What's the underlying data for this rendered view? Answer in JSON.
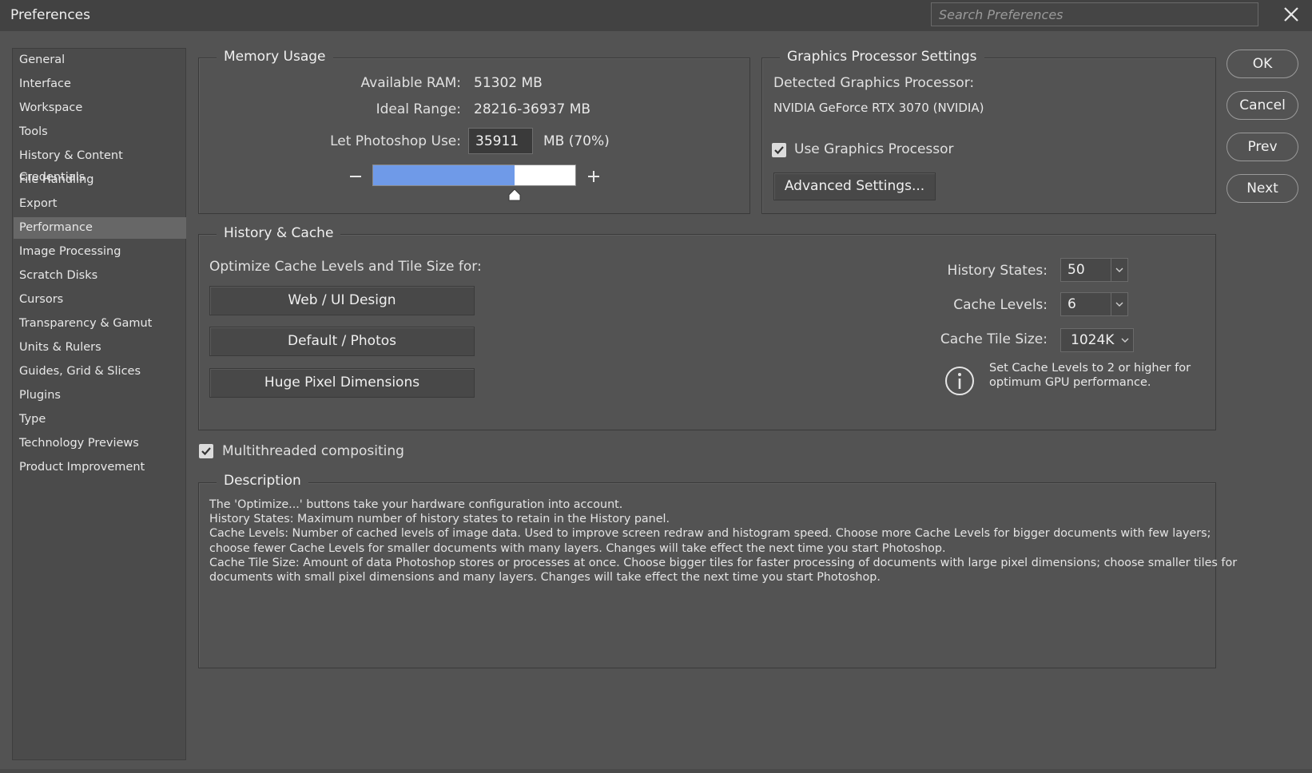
{
  "window": {
    "title": "Preferences",
    "search_placeholder": "Search Preferences"
  },
  "sidebar": {
    "items": [
      {
        "label": "General",
        "active": false
      },
      {
        "label": "Interface",
        "active": false
      },
      {
        "label": "Workspace",
        "active": false
      },
      {
        "label": "Tools",
        "active": false
      },
      {
        "label": "History & Content Credentials",
        "active": false
      },
      {
        "label": "File Handling",
        "active": false
      },
      {
        "label": "Export",
        "active": false
      },
      {
        "label": "Performance",
        "active": true
      },
      {
        "label": "Image Processing",
        "active": false
      },
      {
        "label": "Scratch Disks",
        "active": false
      },
      {
        "label": "Cursors",
        "active": false
      },
      {
        "label": "Transparency & Gamut",
        "active": false
      },
      {
        "label": "Units & Rulers",
        "active": false
      },
      {
        "label": "Guides, Grid & Slices",
        "active": false
      },
      {
        "label": "Plugins",
        "active": false
      },
      {
        "label": "Type",
        "active": false
      },
      {
        "label": "Technology Previews",
        "active": false
      },
      {
        "label": "Product Improvement",
        "active": false
      }
    ]
  },
  "memory": {
    "legend": "Memory Usage",
    "available_label": "Available RAM:",
    "available_value": "51302 MB",
    "ideal_label": "Ideal Range:",
    "ideal_value": "28216-36937 MB",
    "let_use_label": "Let Photoshop Use:",
    "let_use_value": "35911",
    "let_use_unit": "MB (70%)",
    "slider_fraction": 0.7,
    "slider_fill_color": "#6f9ae8"
  },
  "gpu": {
    "legend": "Graphics Processor Settings",
    "detected_label": "Detected Graphics Processor:",
    "detected_value": "NVIDIA GeForce RTX 3070 (NVIDIA)",
    "use_gpu_label": "Use Graphics Processor",
    "use_gpu_checked": true,
    "advanced_button": "Advanced Settings..."
  },
  "history_cache": {
    "legend": "History & Cache",
    "optimize_label": "Optimize Cache Levels and Tile Size for:",
    "buttons": [
      "Web / UI Design",
      "Default / Photos",
      "Huge Pixel Dimensions"
    ],
    "history_states_label": "History States:",
    "history_states_value": "50",
    "cache_levels_label": "Cache Levels:",
    "cache_levels_value": "6",
    "tile_size_label": "Cache Tile Size:",
    "tile_size_value": "1024K",
    "info_line1": "Set Cache Levels to 2 or higher for",
    "info_line2": "optimum GPU performance."
  },
  "multithreaded": {
    "label": "Multithreaded compositing",
    "checked": true
  },
  "description": {
    "legend": "Description",
    "lines": [
      "The 'Optimize...' buttons take your hardware configuration into account.",
      "History States: Maximum number of history states to retain in the History panel.",
      "Cache Levels: Number of cached levels of image data.  Used to improve screen redraw and histogram speed.  Choose more Cache Levels for bigger documents with few layers;",
      "choose fewer Cache Levels for smaller documents with many layers. Changes will take effect the next time you start Photoshop.",
      "Cache Tile Size: Amount of data Photoshop stores or processes at once. Choose bigger tiles for faster processing of documents with large pixel dimensions; choose smaller tiles for",
      "documents with small pixel dimensions and many layers. Changes will take effect the next time you start Photoshop."
    ]
  },
  "actions": {
    "ok": "OK",
    "cancel": "Cancel",
    "prev": "Prev",
    "next": "Next"
  }
}
